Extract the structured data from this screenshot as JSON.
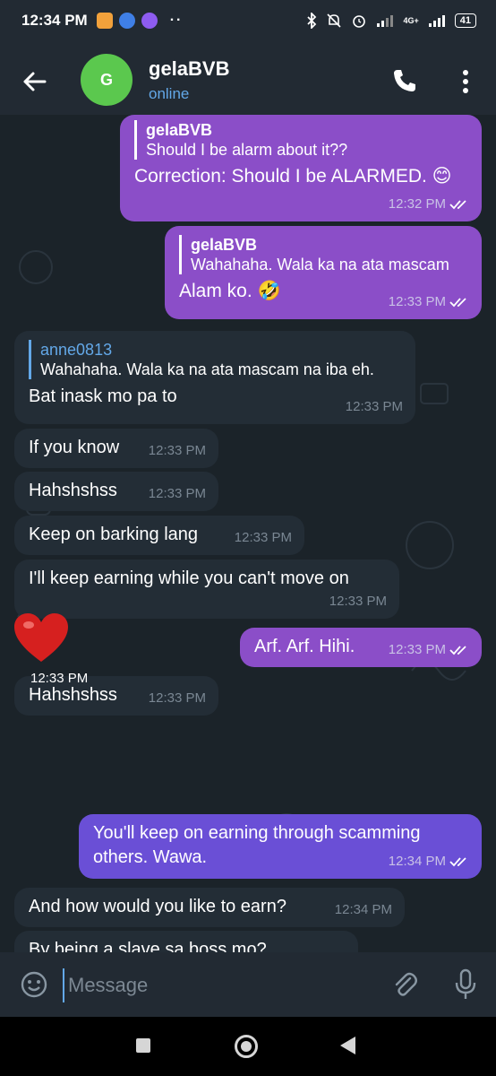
{
  "status": {
    "time": "12:34 PM",
    "dots": "··",
    "network": "4G+",
    "battery": "41"
  },
  "header": {
    "avatar_letter": "G",
    "name": "gelaBVB",
    "status": "online"
  },
  "messages": [
    {
      "id": "m1",
      "reply_name": "gelaBVB",
      "reply_text": "Should I be alarm about it??",
      "text": "Correction: Should I be ALARMED. 😊",
      "time": "12:32 PM"
    },
    {
      "id": "m2",
      "reply_name": "gelaBVB",
      "reply_text": "Wahahaha. Wala ka na ata mascam",
      "text": "Alam ko. 🤣",
      "time": "12:33 PM"
    },
    {
      "id": "m3",
      "reply_name": "anne0813",
      "reply_text": "Wahahaha. Wala ka na ata mascam na iba eh.",
      "text": "Bat inask mo pa to",
      "time": "12:33 PM"
    },
    {
      "id": "m4",
      "text": "If you know",
      "time": "12:33 PM"
    },
    {
      "id": "m5",
      "text": "Hahshshss",
      "time": "12:33 PM"
    },
    {
      "id": "m6",
      "text": "Keep on barking lang",
      "time": "12:33 PM"
    },
    {
      "id": "m7",
      "text": "I'll keep earning while you can't move on",
      "time": "12:33 PM"
    },
    {
      "id": "m8",
      "text": "Arf. Arf. Hihi.",
      "time": "12:33 PM"
    },
    {
      "id": "m9",
      "text": "Hahshshss",
      "time": "12:33 PM"
    },
    {
      "id": "m10",
      "time": "12:33 PM"
    },
    {
      "id": "m11",
      "text": "You'll keep on earning through scamming others. Wawa.",
      "time": "12:34 PM"
    },
    {
      "id": "m12",
      "text": "And how would you like to earn?",
      "time": "12:34 PM"
    },
    {
      "id": "m13",
      "text": "By being a slave sa boss mo?"
    }
  ],
  "input": {
    "placeholder": "Message"
  },
  "colors": {
    "outgoing_purple": "#8b4ec8",
    "outgoing_violet": "#6a4fd6",
    "incoming": "#232d36",
    "accent": "#63a8e8"
  }
}
